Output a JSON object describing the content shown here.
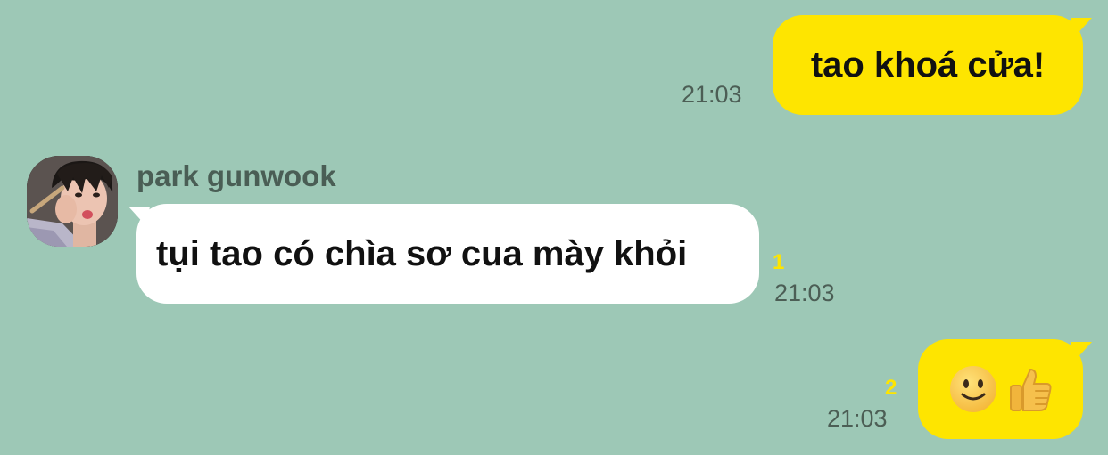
{
  "colors": {
    "background": "#9dc8b6",
    "outgoing_bubble": "#fee500",
    "incoming_bubble": "#ffffff",
    "unread_count": "#fee500"
  },
  "messages": [
    {
      "direction": "outgoing",
      "text": "tao khoá cửa!",
      "time": "21:03"
    },
    {
      "direction": "incoming",
      "sender": "park gunwook",
      "avatar": "profile-photo",
      "text": "tụi tao có chìa sơ cua mày khỏi",
      "unread": "1",
      "time": "21:03"
    },
    {
      "direction": "outgoing",
      "emojis": [
        "slightly-smiling-face",
        "thumbs-up"
      ],
      "unread": "2",
      "time": "21:03"
    }
  ]
}
